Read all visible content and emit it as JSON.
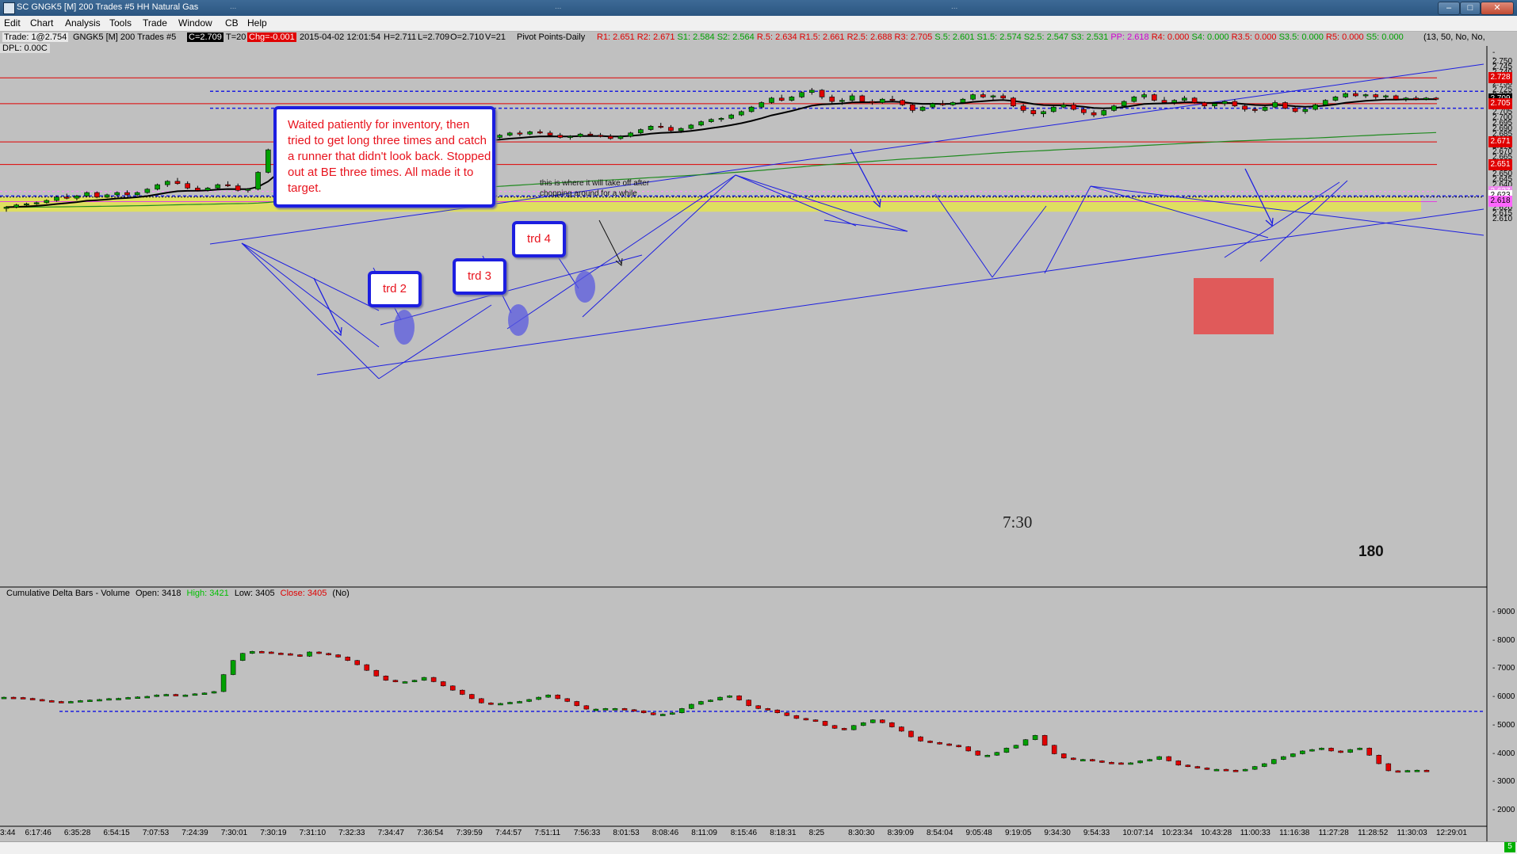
{
  "window": {
    "title": "SC GNGK5 [M]  200 Trades  #5  HH Natural Gas",
    "ghost_tabs": [
      "...",
      "...",
      "..."
    ],
    "controls": {
      "minimize": "–",
      "maximize": "□",
      "close": "✕"
    }
  },
  "menu": [
    "Edit",
    "Chart",
    "Analysis",
    "Tools",
    "Trade",
    "Window",
    "CB",
    "Help"
  ],
  "infobar": {
    "trade": "Trade: 1@2.754",
    "symbol": "GNGK5 [M]  200 Trades  #5",
    "close": "C=2.709",
    "timer": "T=20",
    "change": "Chg=-0.001",
    "datetime": "2015-04-02 12:01:54",
    "hi": "H=2.711",
    "lo": "L=2.709",
    "open": "O=2.710",
    "volume": "V=21",
    "study": "Pivot Points-Daily",
    "pivots": [
      {
        "text": "R1: 2.651",
        "color": "#e00000"
      },
      {
        "text": "R2: 2.671",
        "color": "#e00000"
      },
      {
        "text": "S1: 2.584",
        "color": "#00a000"
      },
      {
        "text": "S2: 2.564",
        "color": "#00a000"
      },
      {
        "text": "R.5: 2.634",
        "color": "#e00000"
      },
      {
        "text": "R1.5: 2.661",
        "color": "#e00000"
      },
      {
        "text": "R2.5: 2.688",
        "color": "#e00000"
      },
      {
        "text": "R3: 2.705",
        "color": "#e00000"
      },
      {
        "text": "S.5: 2.601",
        "color": "#00a000"
      },
      {
        "text": "S1.5: 2.574",
        "color": "#00a000"
      },
      {
        "text": "S2.5: 2.547",
        "color": "#00a000"
      },
      {
        "text": "S3: 2.531",
        "color": "#00a000"
      },
      {
        "text": "PP: 2.618",
        "color": "#d000d0"
      },
      {
        "text": "R4: 0.000",
        "color": "#e00000"
      },
      {
        "text": "S4: 0.000",
        "color": "#00a000"
      },
      {
        "text": "R3.5: 0.000",
        "color": "#e00000"
      },
      {
        "text": "S3.5: 0.000",
        "color": "#00a000"
      },
      {
        "text": "R5: 0.000",
        "color": "#e00000"
      },
      {
        "text": "S5: 0.000",
        "color": "#00a000"
      }
    ],
    "params": "(13, 50, No, No,",
    "dpl": "DPL: 0.00C"
  },
  "annotations": {
    "main": "Waited patiently for inventory, then tried to get long three times and catch a runner that didn't look back.  Stopped out at BE three times.  All made it to target.",
    "trd2": "trd 2",
    "trd3": "trd 3",
    "trd4": "trd 4",
    "note": "this is where it will take off after chopping around for a while",
    "time_label": "7:30",
    "count_label": "180"
  },
  "lower_pane": {
    "title": "Cumulative Delta Bars - Volume",
    "open": "Open: 3418",
    "high": "High: 3421",
    "low": "Low: 3405",
    "close": "Close: 3405",
    "flag": "(No)"
  },
  "price_axis": {
    "ticks": [
      "2.750",
      "2.745",
      "2.740",
      "2.735",
      "2.730",
      "2.725",
      "2.720",
      "2.715",
      "2.710",
      "2.705",
      "2.700",
      "2.695",
      "2.690",
      "2.685",
      "2.680",
      "2.675",
      "2.670",
      "2.665",
      "2.660",
      "2.655",
      "2.650",
      "2.645",
      "2.640",
      "2.635",
      "2.630",
      "2.625",
      "2.620",
      "2.615",
      "2.610"
    ],
    "tags": [
      {
        "text": "2.728",
        "price": 2.728,
        "bg": "#e00000",
        "fg": "#ffffff"
      },
      {
        "text": "2.709",
        "price": 2.709,
        "bg": "#000000",
        "fg": "#ffffff"
      },
      {
        "text": "2.705",
        "price": 2.705,
        "bg": "#e00000",
        "fg": "#ffffff"
      },
      {
        "text": "2.671",
        "price": 2.671,
        "bg": "#e00000",
        "fg": "#ffffff"
      },
      {
        "text": "2.651",
        "price": 2.651,
        "bg": "#e00000",
        "fg": "#ffffff"
      },
      {
        "text": "2.627",
        "price": 2.627,
        "bg": "#ee88ee",
        "fg": "#ffffff"
      },
      {
        "text": "2.623",
        "price": 2.623,
        "bg": "#ffffff",
        "fg": "#000000"
      },
      {
        "text": "2.618",
        "price": 2.618,
        "bg": "#ff66ff",
        "fg": "#000000"
      }
    ]
  },
  "delta_axis": {
    "ticks": [
      "9000",
      "8000",
      "7000",
      "6000",
      "5000",
      "4000",
      "3000",
      "2000"
    ]
  },
  "time_axis": [
    "3:44",
    "6:17:46",
    "6:35:28",
    "6:54:15",
    "7:07:53",
    "7:24:39",
    "7:30:01",
    "7:30:19",
    "7:31:10",
    "7:32:33",
    "7:34:47",
    "7:36:54",
    "7:39:59",
    "7:44:57",
    "7:51:11",
    "7:56:33",
    "8:01:53",
    "8:08:46",
    "8:11:09",
    "8:15:46",
    "8:18:31",
    "8:25",
    "8:30:30",
    "8:39:09",
    "8:54:04",
    "9:05:48",
    "9:19:05",
    "9:34:30",
    "9:54:33",
    "10:07:14",
    "10:23:34",
    "10:43:28",
    "11:00:33",
    "11:16:38",
    "11:27:28",
    "11:28:52",
    "11:30:03",
    "12:29:01"
  ],
  "status_tag": "5",
  "chart_data": {
    "type": "candlestick",
    "price_levels": {
      "red_lines": [
        2.728,
        2.705,
        2.671,
        2.651
      ],
      "blue_dashed": [
        2.716,
        2.701,
        2.623
      ],
      "pink_dotted": 2.627,
      "magenta_line": 2.618,
      "shaded_zone": [
        2.609,
        2.622
      ]
    },
    "candles": [
      [
        2.612,
        2.614,
        2.609,
        2.613
      ],
      [
        2.613,
        2.616,
        2.612,
        2.615
      ],
      [
        2.615,
        2.617,
        2.614,
        2.616
      ],
      [
        2.616,
        2.618,
        2.615,
        2.617
      ],
      [
        2.617,
        2.62,
        2.616,
        2.619
      ],
      [
        2.619,
        2.623,
        2.618,
        2.622
      ],
      [
        2.622,
        2.625,
        2.62,
        2.621
      ],
      [
        2.621,
        2.624,
        2.619,
        2.623
      ],
      [
        2.623,
        2.627,
        2.622,
        2.626
      ],
      [
        2.626,
        2.627,
        2.621,
        2.622
      ],
      [
        2.622,
        2.625,
        2.621,
        2.624
      ],
      [
        2.624,
        2.627,
        2.623,
        2.626
      ],
      [
        2.626,
        2.628,
        2.623,
        2.624
      ],
      [
        2.624,
        2.627,
        2.623,
        2.626
      ],
      [
        2.626,
        2.63,
        2.625,
        2.629
      ],
      [
        2.629,
        2.634,
        2.628,
        2.633
      ],
      [
        2.633,
        2.637,
        2.631,
        2.636
      ],
      [
        2.636,
        2.639,
        2.633,
        2.634
      ],
      [
        2.634,
        2.636,
        2.629,
        2.63
      ],
      [
        2.63,
        2.632,
        2.627,
        2.628
      ],
      [
        2.628,
        2.631,
        2.627,
        2.63
      ],
      [
        2.63,
        2.634,
        2.629,
        2.633
      ],
      [
        2.633,
        2.636,
        2.631,
        2.632
      ],
      [
        2.632,
        2.634,
        2.627,
        2.628
      ],
      [
        2.628,
        2.63,
        2.626,
        2.629
      ],
      [
        2.629,
        2.645,
        2.628,
        2.644
      ],
      [
        2.644,
        2.665,
        2.643,
        2.664
      ],
      [
        2.664,
        2.69,
        2.662,
        2.688
      ],
      [
        2.688,
        2.701,
        2.684,
        2.69
      ],
      [
        2.69,
        2.694,
        2.673,
        2.676
      ],
      [
        2.676,
        2.682,
        2.668,
        2.678
      ],
      [
        2.678,
        2.69,
        2.676,
        2.688
      ],
      [
        2.688,
        2.69,
        2.678,
        2.68
      ],
      [
        2.68,
        2.682,
        2.673,
        2.675
      ],
      [
        2.675,
        2.678,
        2.671,
        2.672
      ],
      [
        2.672,
        2.676,
        2.67,
        2.675
      ],
      [
        2.675,
        2.678,
        2.672,
        2.676
      ],
      [
        2.676,
        2.681,
        2.675,
        2.68
      ],
      [
        2.68,
        2.682,
        2.676,
        2.677
      ],
      [
        2.677,
        2.679,
        2.672,
        2.673
      ],
      [
        2.673,
        2.675,
        2.67,
        2.671
      ],
      [
        2.671,
        2.673,
        2.669,
        2.672
      ],
      [
        2.672,
        2.675,
        2.671,
        2.673
      ],
      [
        2.673,
        2.677,
        2.672,
        2.676
      ],
      [
        2.676,
        2.678,
        2.673,
        2.674
      ],
      [
        2.674,
        2.676,
        2.67,
        2.671
      ],
      [
        2.671,
        2.673,
        2.668,
        2.67
      ],
      [
        2.67,
        2.673,
        2.669,
        2.672
      ],
      [
        2.672,
        2.676,
        2.671,
        2.675
      ],
      [
        2.675,
        2.678,
        2.674,
        2.677
      ],
      [
        2.677,
        2.68,
        2.676,
        2.679
      ],
      [
        2.679,
        2.681,
        2.676,
        2.678
      ],
      [
        2.678,
        2.681,
        2.677,
        2.68
      ],
      [
        2.68,
        2.682,
        2.678,
        2.679
      ],
      [
        2.679,
        2.681,
        2.676,
        2.677
      ],
      [
        2.677,
        2.679,
        2.674,
        2.675
      ],
      [
        2.675,
        2.677,
        2.673,
        2.676
      ],
      [
        2.676,
        2.679,
        2.675,
        2.678
      ],
      [
        2.678,
        2.68,
        2.676,
        2.677
      ],
      [
        2.677,
        2.679,
        2.675,
        2.676
      ],
      [
        2.676,
        2.678,
        2.673,
        2.674
      ],
      [
        2.674,
        2.677,
        2.673,
        2.676
      ],
      [
        2.676,
        2.68,
        2.675,
        2.679
      ],
      [
        2.679,
        2.683,
        2.678,
        2.682
      ],
      [
        2.682,
        2.686,
        2.681,
        2.685
      ],
      [
        2.685,
        2.688,
        2.683,
        2.684
      ],
      [
        2.684,
        2.686,
        2.68,
        2.681
      ],
      [
        2.681,
        2.684,
        2.679,
        2.683
      ],
      [
        2.683,
        2.687,
        2.682,
        2.686
      ],
      [
        2.686,
        2.69,
        2.685,
        2.689
      ],
      [
        2.689,
        2.692,
        2.688,
        2.691
      ],
      [
        2.691,
        2.693,
        2.689,
        2.692
      ],
      [
        2.692,
        2.696,
        2.691,
        2.695
      ],
      [
        2.695,
        2.699,
        2.694,
        2.698
      ],
      [
        2.698,
        2.703,
        2.697,
        2.702
      ],
      [
        2.702,
        2.707,
        2.701,
        2.706
      ],
      [
        2.706,
        2.711,
        2.705,
        2.71
      ],
      [
        2.71,
        2.713,
        2.707,
        2.708
      ],
      [
        2.708,
        2.712,
        2.707,
        2.711
      ],
      [
        2.711,
        2.716,
        2.71,
        2.715
      ],
      [
        2.715,
        2.719,
        2.713,
        2.717
      ],
      [
        2.717,
        2.718,
        2.709,
        2.711
      ],
      [
        2.711,
        2.713,
        2.705,
        2.707
      ],
      [
        2.707,
        2.71,
        2.704,
        2.708
      ],
      [
        2.708,
        2.714,
        2.707,
        2.712
      ],
      [
        2.712,
        2.713,
        2.706,
        2.707
      ],
      [
        2.707,
        2.709,
        2.704,
        2.706
      ],
      [
        2.706,
        2.71,
        2.705,
        2.709
      ],
      [
        2.709,
        2.712,
        2.707,
        2.708
      ],
      [
        2.708,
        2.709,
        2.703,
        2.704
      ],
      [
        2.704,
        2.706,
        2.697,
        2.699
      ],
      [
        2.699,
        2.703,
        2.698,
        2.702
      ],
      [
        2.702,
        2.706,
        2.701,
        2.705
      ],
      [
        2.705,
        2.708,
        2.703,
        2.704
      ],
      [
        2.704,
        2.707,
        2.703,
        2.706
      ],
      [
        2.706,
        2.71,
        2.705,
        2.709
      ],
      [
        2.709,
        2.714,
        2.708,
        2.713
      ],
      [
        2.713,
        2.715,
        2.71,
        2.711
      ],
      [
        2.711,
        2.713,
        2.708,
        2.712
      ],
      [
        2.712,
        2.714,
        2.709,
        2.71
      ],
      [
        2.71,
        2.711,
        2.702,
        2.703
      ],
      [
        2.703,
        2.705,
        2.697,
        2.699
      ],
      [
        2.699,
        2.701,
        2.694,
        2.696
      ],
      [
        2.696,
        2.699,
        2.693,
        2.698
      ],
      [
        2.698,
        2.703,
        2.697,
        2.702
      ],
      [
        2.702,
        2.706,
        2.701,
        2.704
      ],
      [
        2.704,
        2.706,
        2.699,
        2.7
      ],
      [
        2.7,
        2.701,
        2.695,
        2.697
      ],
      [
        2.697,
        2.699,
        2.693,
        2.695
      ],
      [
        2.695,
        2.7,
        2.694,
        2.699
      ],
      [
        2.699,
        2.704,
        2.698,
        2.703
      ],
      [
        2.703,
        2.708,
        2.702,
        2.707
      ],
      [
        2.707,
        2.712,
        2.706,
        2.711
      ],
      [
        2.711,
        2.715,
        2.709,
        2.713
      ],
      [
        2.713,
        2.714,
        2.707,
        2.708
      ],
      [
        2.708,
        2.711,
        2.705,
        2.706
      ],
      [
        2.706,
        2.709,
        2.704,
        2.708
      ],
      [
        2.708,
        2.712,
        2.707,
        2.71
      ],
      [
        2.71,
        2.711,
        2.705,
        2.706
      ],
      [
        2.706,
        2.707,
        2.701,
        2.703
      ],
      [
        2.703,
        2.706,
        2.701,
        2.705
      ],
      [
        2.705,
        2.708,
        2.703,
        2.707
      ],
      [
        2.707,
        2.709,
        2.702,
        2.703
      ],
      [
        2.703,
        2.704,
        2.698,
        2.7
      ],
      [
        2.7,
        2.702,
        2.697,
        2.699
      ],
      [
        2.699,
        2.703,
        2.698,
        2.702
      ],
      [
        2.702,
        2.708,
        2.701,
        2.706
      ],
      [
        2.706,
        2.707,
        2.7,
        2.701
      ],
      [
        2.701,
        2.703,
        2.697,
        2.698
      ],
      [
        2.698,
        2.701,
        2.696,
        2.7
      ],
      [
        2.7,
        2.705,
        2.699,
        2.704
      ],
      [
        2.704,
        2.709,
        2.703,
        2.708
      ],
      [
        2.708,
        2.712,
        2.707,
        2.711
      ],
      [
        2.711,
        2.715,
        2.71,
        2.714
      ],
      [
        2.714,
        2.716,
        2.711,
        2.712
      ],
      [
        2.712,
        2.714,
        2.71,
        2.713
      ],
      [
        2.713,
        2.714,
        2.709,
        2.711
      ],
      [
        2.711,
        2.713,
        2.709,
        2.712
      ],
      [
        2.712,
        2.713,
        2.708,
        2.709
      ],
      [
        2.709,
        2.711,
        2.707,
        2.71
      ],
      [
        2.71,
        2.712,
        2.708,
        2.709
      ],
      [
        2.709,
        2.711,
        2.708,
        2.71
      ],
      [
        2.71,
        2.711,
        2.708,
        2.709
      ]
    ],
    "ema_color": "#000000",
    "slow_ma_color": "#1f8a1f",
    "delta": {
      "values": [
        6000,
        5990,
        5960,
        5920,
        5880,
        5850,
        5830,
        5850,
        5880,
        5900,
        5920,
        5950,
        5960,
        5990,
        6010,
        6030,
        6080,
        6100,
        6080,
        6080,
        6120,
        6150,
        6200,
        6800,
        7300,
        7550,
        7620,
        7600,
        7560,
        7540,
        7500,
        7450,
        7600,
        7550,
        7500,
        7420,
        7300,
        7150,
        6950,
        6750,
        6600,
        6550,
        6550,
        6600,
        6700,
        6550,
        6400,
        6250,
        6100,
        5950,
        5800,
        5750,
        5780,
        5820,
        5850,
        5920,
        6000,
        6080,
        5950,
        5850,
        5700,
        5580,
        5580,
        5600,
        5600,
        5560,
        5520,
        5450,
        5380,
        5400,
        5450,
        5600,
        5750,
        5850,
        5900,
        6000,
        6050,
        5900,
        5700,
        5600,
        5550,
        5450,
        5350,
        5250,
        5200,
        5150,
        5000,
        4900,
        4850,
        5000,
        5100,
        5200,
        5100,
        4950,
        4800,
        4600,
        4450,
        4400,
        4350,
        4300,
        4250,
        4100,
        3950,
        3950,
        4050,
        4200,
        4300,
        4500,
        4650,
        4300,
        4000,
        3850,
        3800,
        3800,
        3750,
        3700,
        3680,
        3650,
        3680,
        3750,
        3800,
        3900,
        3750,
        3600,
        3550,
        3500,
        3450,
        3450,
        3420,
        3400,
        3450,
        3550,
        3650,
        3800,
        3900,
        4000,
        4100,
        4150,
        4200,
        4100,
        4050,
        4150,
        4200,
        3950,
        3650,
        3400,
        3380,
        3410,
        3420,
        3405
      ],
      "dashed_level": 5500
    }
  }
}
